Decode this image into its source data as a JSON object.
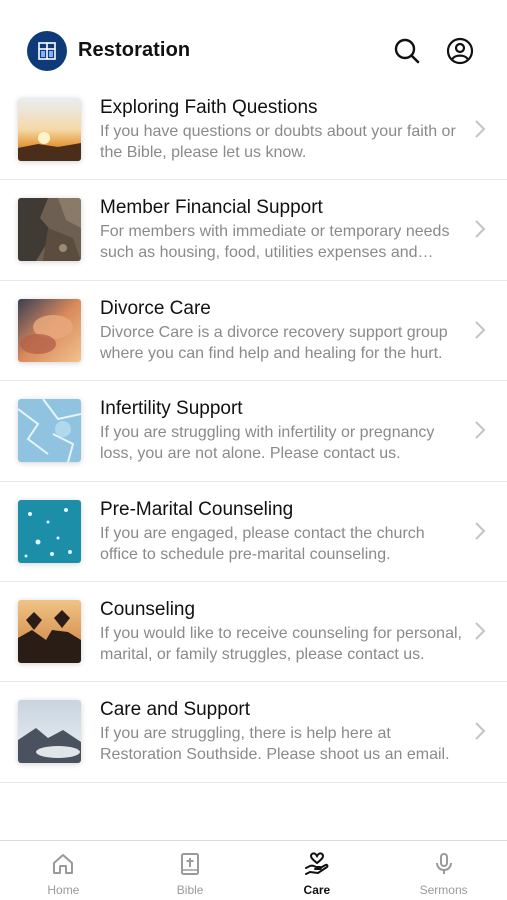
{
  "header": {
    "title": "Restoration",
    "logo_icon": "church-window-icon",
    "search_icon": "search-icon",
    "profile_icon": "profile-icon",
    "brand_color": "#0e3a7a"
  },
  "items": [
    {
      "title": "Exploring Faith Questions",
      "description": "If you have questions or doubts about your faith or the Bible, please let us know.",
      "thumb": "sunset-photo"
    },
    {
      "title": "Member Financial Support",
      "description": "For members with immediate or temporary needs such as housing, food, utilities expenses and more.",
      "thumb": "rocky-cliff-photo"
    },
    {
      "title": "Divorce Care",
      "description": "Divorce Care is a divorce recovery support group where you can find help and healing for the hurt.",
      "thumb": "clouds-sunset-photo"
    },
    {
      "title": "Infertility Support",
      "description": "If you are struggling with infertility or pregnancy loss, you are not alone.  Please contact us.",
      "thumb": "frost-photo"
    },
    {
      "title": "Pre-Marital Counseling",
      "description": "If you are engaged, please contact the church office to schedule pre-marital counseling.",
      "thumb": "water-drops-photo"
    },
    {
      "title": "Counseling",
      "description": "If you would like to receive counseling for personal, marital, or family struggles, please contact us.",
      "thumb": "heart-hands-photo"
    },
    {
      "title": "Care and Support",
      "description": "If you are struggling, there is help here at Restoration Southside. Please shoot us an email.",
      "thumb": "mountain-clouds-photo"
    }
  ],
  "tabs": [
    {
      "label": "Home",
      "icon": "home-icon",
      "active": false
    },
    {
      "label": "Bible",
      "icon": "bible-icon",
      "active": false
    },
    {
      "label": "Care",
      "icon": "care-hand-heart-icon",
      "active": true
    },
    {
      "label": "Sermons",
      "icon": "microphone-icon",
      "active": false
    }
  ]
}
